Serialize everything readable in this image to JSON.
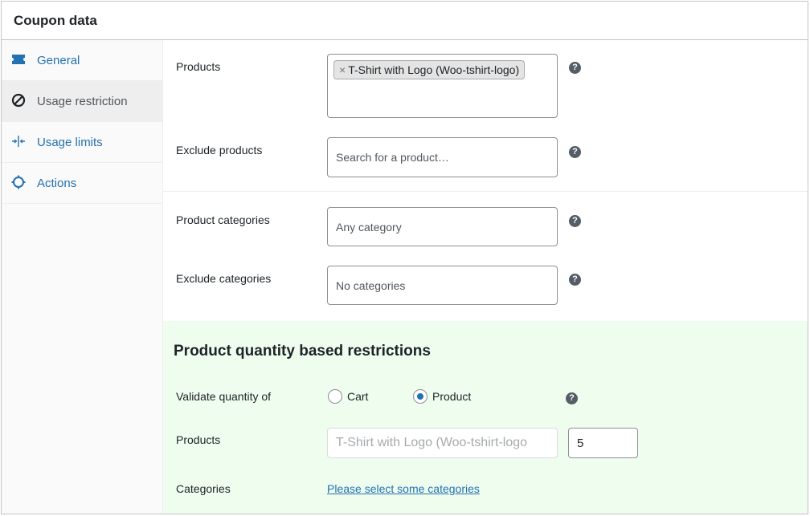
{
  "panel": {
    "title": "Coupon data"
  },
  "sidebar": {
    "tabs": [
      {
        "label": "General",
        "icon": "ticket-icon",
        "active": false
      },
      {
        "label": "Usage restriction",
        "icon": "block-icon",
        "active": true
      },
      {
        "label": "Usage limits",
        "icon": "limits-icon",
        "active": false
      },
      {
        "label": "Actions",
        "icon": "gear-icon",
        "active": false
      }
    ]
  },
  "fields": {
    "products": {
      "label": "Products",
      "selected": [
        "T-Shirt with Logo (Woo-tshirt-logo)"
      ],
      "remove_glyph": "×"
    },
    "exclude_products": {
      "label": "Exclude products",
      "placeholder": "Search for a product…"
    },
    "product_categories": {
      "label": "Product categories",
      "placeholder": "Any category"
    },
    "exclude_categories": {
      "label": "Exclude categories",
      "placeholder": "No categories"
    },
    "help_glyph": "?"
  },
  "quantity": {
    "title": "Product quantity based restrictions",
    "validate_label": "Validate quantity of",
    "options": [
      {
        "label": "Cart",
        "selected": false
      },
      {
        "label": "Product",
        "selected": true
      }
    ],
    "products_label": "Products",
    "products_value": "T-Shirt with Logo (Woo-tshirt-logo",
    "quantity_value": "5",
    "categories_label": "Categories",
    "categories_link": "Please select some categories"
  },
  "colors": {
    "accent": "#2271b1",
    "section_bg": "#effdef",
    "help_bg": "#555d66"
  }
}
